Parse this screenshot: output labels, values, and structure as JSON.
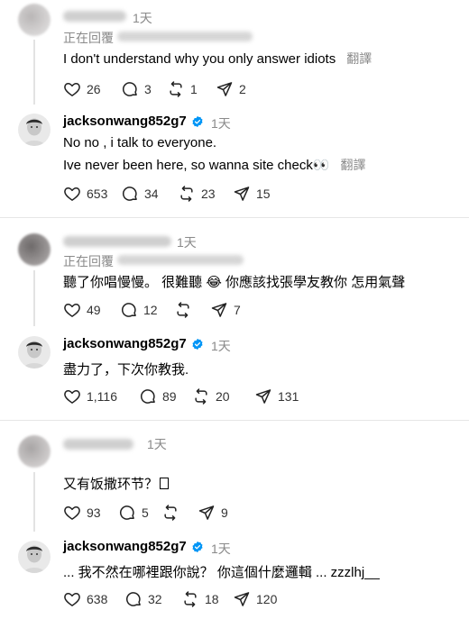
{
  "threads": [
    {
      "reply": {
        "time": "1天",
        "replying_prefix": "正在回覆",
        "text": "I don't understand why you only answer idiots",
        "translate": "翻譯",
        "likes": "26",
        "comments": "3",
        "reposts": "1",
        "shares": "2"
      },
      "answer": {
        "username": "jacksonwang852g7",
        "time": "1天",
        "line1": "No no , i talk to everyone.",
        "line2": "Ive never been here, so wanna site check",
        "emoji": "👀",
        "translate": "翻譯",
        "likes": "653",
        "comments": "34",
        "reposts": "23",
        "shares": "15"
      }
    },
    {
      "reply": {
        "time": "1天",
        "replying_prefix": "正在回覆",
        "text_a": "聽了你唱慢慢。 很難聽",
        "emoji": "😂",
        "text_b": "你應該找張學友教你 怎用氣聲",
        "likes": "49",
        "comments": "12",
        "reposts": "",
        "shares": "7"
      },
      "answer": {
        "username": "jacksonwang852g7",
        "time": "1天",
        "line1": "盡力了，下次你教我.",
        "likes": "1,116",
        "comments": "89",
        "reposts": "20",
        "shares": "131"
      }
    },
    {
      "reply": {
        "time": "1天",
        "text": "又有饭撒环节？",
        "likes": "93",
        "comments": "5",
        "reposts": "",
        "shares": "9"
      },
      "answer": {
        "username": "jacksonwang852g7",
        "time": "1天",
        "line1": "... 我不然在哪裡跟你說？ 你這個什麼邏輯 ... zzzlhj__",
        "likes": "638",
        "comments": "32",
        "reposts": "18",
        "shares": "120"
      }
    }
  ],
  "colors": {
    "verified": "#0095f6",
    "muted": "#8a8a8a"
  }
}
